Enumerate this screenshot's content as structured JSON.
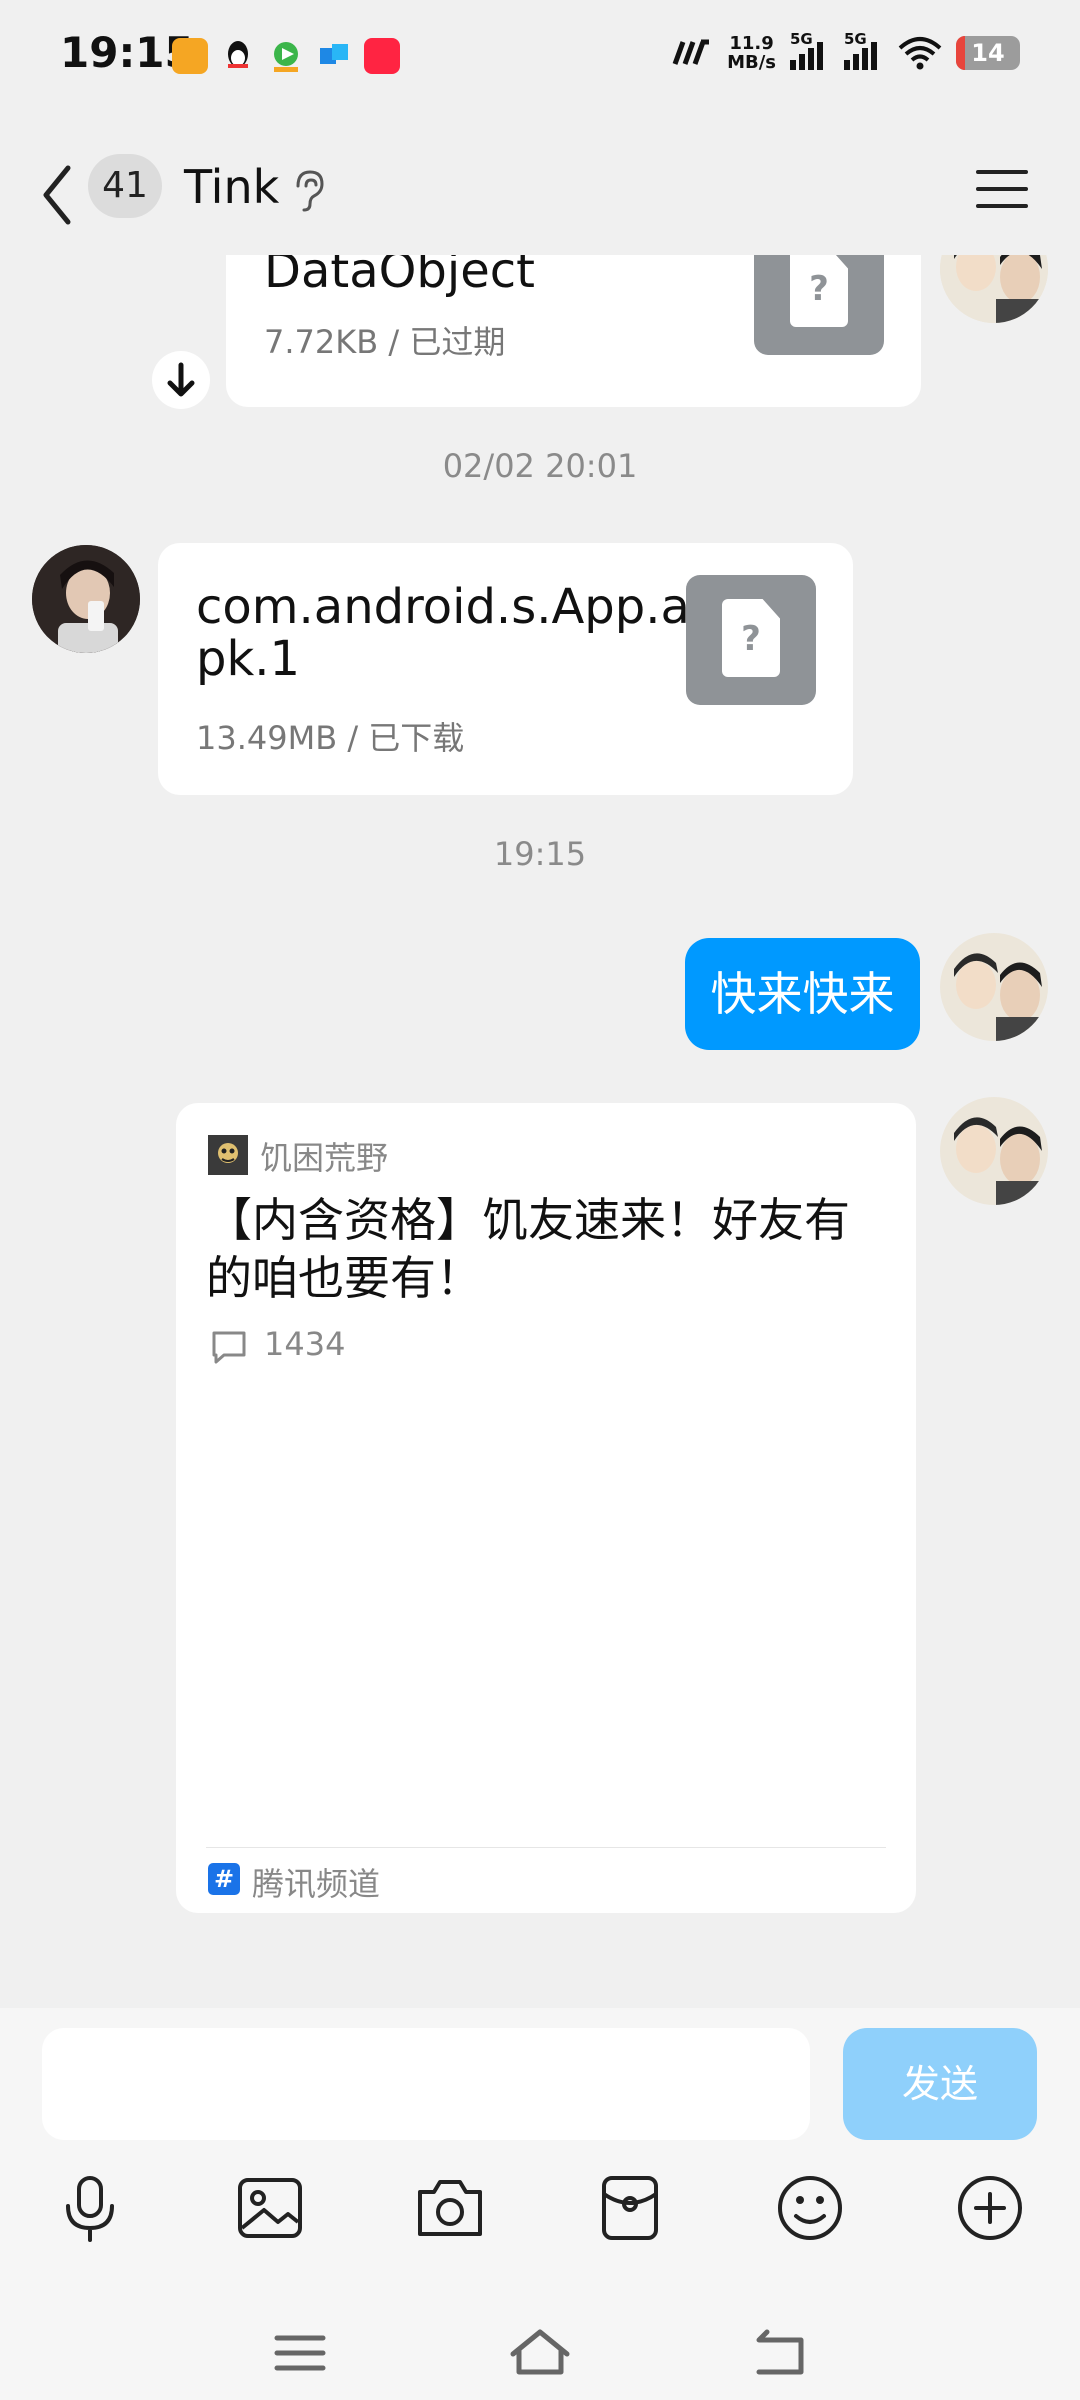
{
  "status_bar": {
    "time": "19:15",
    "net_speed_value": "11.9",
    "net_speed_unit": "MB/s",
    "signal1_label": "5G",
    "signal2_label": "5G",
    "battery": "14",
    "app_icons": [
      "notes-app-icon",
      "qq-icon",
      "video-app-icon",
      "tencent-docs-icon",
      "xiaohongshu-icon"
    ]
  },
  "header": {
    "unread_count": "41",
    "title": "Tink"
  },
  "messages": {
    "file1": {
      "name": "DataObject",
      "meta": "7.72KB / 已过期"
    },
    "timestamp1": "02/02 20:01",
    "file2": {
      "name_line1": "com.android.s.App.a",
      "name_line2": "pk.1",
      "meta": "13.49MB / 已下载"
    },
    "timestamp2": "19:15",
    "text_sent": "快来快来",
    "share_card": {
      "channel": "饥困荒野",
      "title": "【内含资格】饥友速来！好友有的咱也要有！",
      "comments": "1434",
      "source": "腾讯频道",
      "source_icon": "#"
    }
  },
  "input": {
    "value": "",
    "send_label": "发送"
  },
  "colors": {
    "accent": "#0099ff",
    "send_disabled": "#8fd0fb",
    "background": "#f0f0f0"
  }
}
